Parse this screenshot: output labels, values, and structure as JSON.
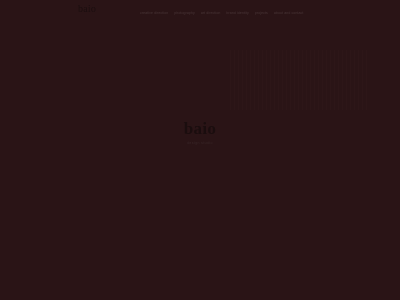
{
  "header": {
    "logo": "baio",
    "nav": [
      "creative direction",
      "photography",
      "art direction",
      "brand identity",
      "projects",
      "about and contact"
    ]
  },
  "hero": {
    "title": "baio",
    "subtitle": "design studio"
  },
  "colors": {
    "background": "#2a1416",
    "text_dark": "#1a0d0e",
    "nav_text": "#4a3638"
  }
}
